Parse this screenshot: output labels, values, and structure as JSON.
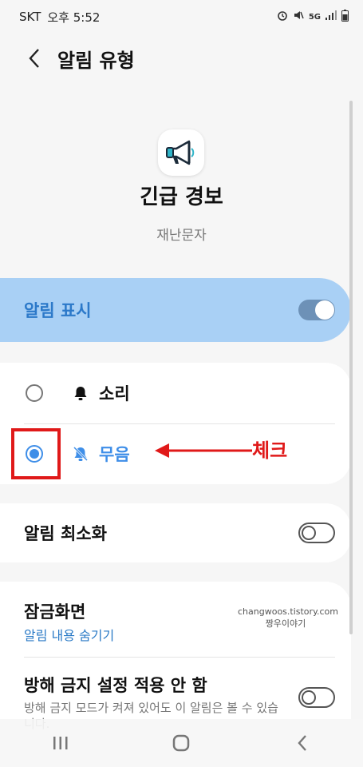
{
  "status_bar": {
    "carrier": "SKT",
    "time": "오후 5:52",
    "network": "5G"
  },
  "header": {
    "title": "알림 유형"
  },
  "app": {
    "name": "긴급 경보",
    "category": "재난문자",
    "icon": "megaphone-icon"
  },
  "master_toggle": {
    "label": "알림 표시",
    "on": true
  },
  "alert_mode": {
    "options": [
      {
        "label": "소리",
        "icon": "bell-icon",
        "selected": false
      },
      {
        "label": "무음",
        "icon": "bell-off-icon",
        "selected": true
      }
    ]
  },
  "annotation": {
    "text": "체크",
    "color": "#e01919"
  },
  "minimize": {
    "label": "알림 최소화",
    "on": false
  },
  "lock_screen": {
    "title": "잠금화면",
    "subtitle": "알림 내용 숨기기"
  },
  "watermark": {
    "line1": "changwoos.tistory.com",
    "line2": "짱우이야기"
  },
  "dnd": {
    "title": "방해 금지 설정 적용 안 함",
    "description": "방해 금지 모드가 켜져 있어도 이 알림은 볼 수 있습니다.",
    "on": false
  },
  "colors": {
    "accent": "#3e8ee8",
    "master_bg": "#a9d0f5",
    "link": "#2a7ac6",
    "annotation": "#e01919"
  }
}
